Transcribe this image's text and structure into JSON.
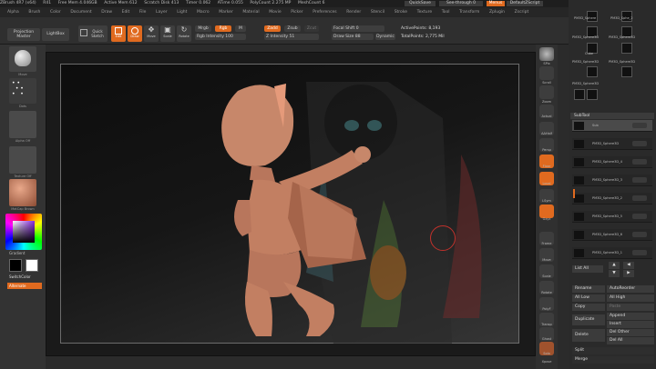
{
  "titlebar": {
    "items": [
      "ZBrush 4R7 (x64)",
      "R41",
      "Free Mem 4.046GB",
      "Active Mem 612",
      "Scratch Disk 413",
      "Timer 0.062",
      "ATime 0.055",
      "PolyCount 2.275 MP",
      "MeshCount 6"
    ],
    "quicksave": "QuickSave",
    "see_through": "See-through  0",
    "menus_label": "Menus",
    "script": "DefaultZScript"
  },
  "menubar": {
    "items": [
      "Alpha",
      "Brush",
      "Color",
      "Document",
      "Draw",
      "Edit",
      "File",
      "Layer",
      "Light",
      "Macro",
      "Marker",
      "Material",
      "Movie",
      "Picker",
      "Preferences",
      "Render",
      "Stencil",
      "Stroke",
      "Texture",
      "Tool",
      "Transform",
      "Zplugin",
      "Zscript"
    ]
  },
  "shelf": {
    "projection_master": "Projection Master",
    "lightbox": "LightBox",
    "quick_sketch": "Quick Sketch",
    "edit": "Edit",
    "draw": "Draw",
    "move": "Move",
    "scale": "Scale",
    "rotate": "Rotate",
    "mrgb": "Mrgb",
    "rgb": "Rgb",
    "m": "M",
    "rgb_intensity": "Rgb Intensity 100",
    "zadd": "Zadd",
    "zsub": "Zsub",
    "zcut": "Zcut",
    "z_intensity": "Z Intensity 51",
    "focal_shift": "Focal Shift 0",
    "draw_size": "Draw Size 88",
    "dynamic": "Dynamic",
    "active_points": "ActivePoints: 8,193",
    "total_points": "TotalPoints: 2,775 Mil"
  },
  "left_tray": {
    "brush_label": "Move",
    "stroke_label": "Dots",
    "alpha_label": "Alpha Off",
    "texture_label": "Texture Off",
    "material_label": "MatCap Brown",
    "gradient": "Gradient",
    "switch_color": "SwitchColor",
    "alternate": "Alternate"
  },
  "right_tray": {
    "labels": [
      "SPix",
      "Scroll",
      "Zoom",
      "Actual",
      "AAHalf",
      "Persp",
      "Floor",
      "Local",
      "LSym",
      "Gxyz",
      "Frame",
      "Move",
      "Scale",
      "Rotate",
      "PolyF",
      "Transp",
      "Ghost",
      "Solo",
      "Xpose"
    ]
  },
  "tool_panel": {
    "thumb_labels": [
      "PM3D_Sphere",
      "PM3D_Sphe_2",
      "PM3D_Sphere3D",
      "PM3D_Sphere3D",
      "Cube",
      "PM3D_Sphere3D",
      "PM3D_Sphere3D",
      "PM3D_Sphere3D"
    ],
    "subtool_header": "SubTool",
    "subtools": [
      "Sub",
      "PM3D_Sphere3D",
      "PM3D_Sphere3D_4",
      "PM3D_Sphere3D_3",
      "PM3D_Sphere3D_2",
      "PM3D_Sphere3D_5",
      "PM3D_Sphere3D_6",
      "PM3D_Sphere3D_1"
    ],
    "list_all": "List All",
    "rename": "Rename",
    "auto_reorder": "AutoReorder",
    "all_low": "All Low",
    "all_high": "All High",
    "copy": "Copy",
    "paste": "Paste",
    "duplicate": "Duplicate",
    "append": "Append",
    "insert": "Insert",
    "delete": "Delete",
    "del_other": "Del Other",
    "del_all": "Del All",
    "split": "Split",
    "merge": "Merge"
  },
  "colors": {
    "accent": "#e06a1f",
    "model": "#c7876a",
    "crosshair": "#c0312b"
  }
}
